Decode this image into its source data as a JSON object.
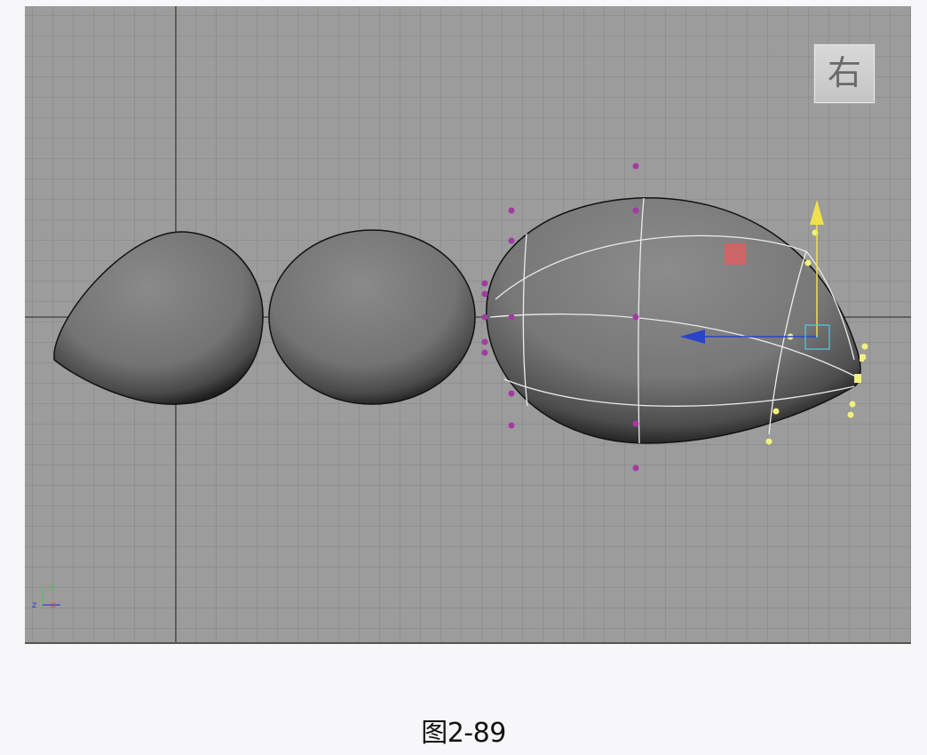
{
  "viewport": {
    "view_label": "右",
    "axis_labels": {
      "y": "y",
      "z": "z",
      "x": "x"
    },
    "colors": {
      "grid_background": "#9c9c9c",
      "grid_line": "#808080",
      "grid_major": "#3a3a3a",
      "surface": "#7a7a7a",
      "wireframe": "#e8e8e8",
      "cv_point": "#a33aa3",
      "selected_cv": "#f2f27a",
      "manipulator_x": "#2a44c8",
      "manipulator_y": "#f0e050",
      "manipulator_center": "#5fc0d8",
      "manipulator_plane": "#d96060"
    }
  },
  "caption": "图2-89"
}
